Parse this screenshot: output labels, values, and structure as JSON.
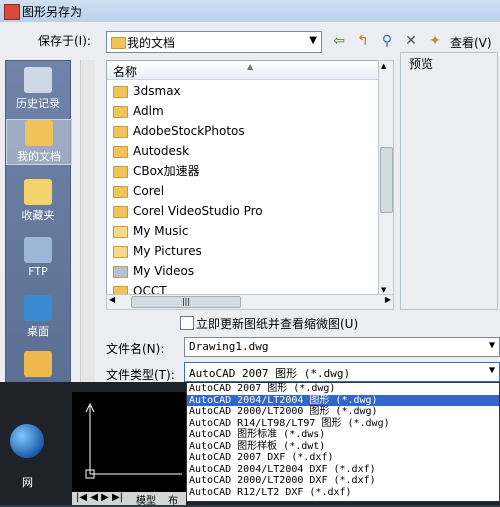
{
  "window": {
    "title": "图形另存为"
  },
  "save_in": {
    "label": "保存于(I):",
    "value": "我的文档"
  },
  "toolbar": {
    "view_label": "查看(V)"
  },
  "places": [
    {
      "label": "历史记录",
      "icon": "history-icon"
    },
    {
      "label": "我的文档",
      "icon": "my-documents-icon"
    },
    {
      "label": "收藏夹",
      "icon": "favorites-icon"
    },
    {
      "label": "FTP",
      "icon": "ftp-icon"
    },
    {
      "label": "桌面",
      "icon": "desktop-icon"
    }
  ],
  "file_list": {
    "column_header": "名称",
    "items": [
      "3dsmax",
      "Adlm",
      "AdobeStockPhotos",
      "Autodesk",
      "CBox加速器",
      "Corel",
      "Corel VideoStudio Pro",
      "My Music",
      "My Pictures",
      "My Videos",
      "OCCT"
    ]
  },
  "preview": {
    "label": "预览"
  },
  "update_thumbnail": {
    "label": "立即更新图纸并查看缩微图(U)"
  },
  "file_name": {
    "label": "文件名(N):",
    "value": "Drawing1.dwg"
  },
  "file_type": {
    "label": "文件类型(T):",
    "value": "AutoCAD 2007 图形 (*.dwg)",
    "options": [
      "AutoCAD 2007 图形 (*.dwg)",
      "AutoCAD 2004/LT2004 图形 (*.dwg)",
      "AutoCAD 2000/LT2000 图形 (*.dwg)",
      "AutoCAD R14/LT98/LT97 图形 (*.dwg)",
      "AutoCAD 图形标准 (*.dws)",
      "AutoCAD 图形样板 (*.dwt)",
      "AutoCAD 2007 DXF (*.dxf)",
      "AutoCAD 2004/LT2004 DXF (*.dxf)",
      "AutoCAD 2000/LT2000 DXF (*.dxf)",
      "AutoCAD R12/LT2 DXF (*.dxf)"
    ],
    "highlighted_index": 1
  },
  "background": {
    "desktop_label": "网",
    "model_tab": "模型",
    "layout_tab": "布"
  }
}
